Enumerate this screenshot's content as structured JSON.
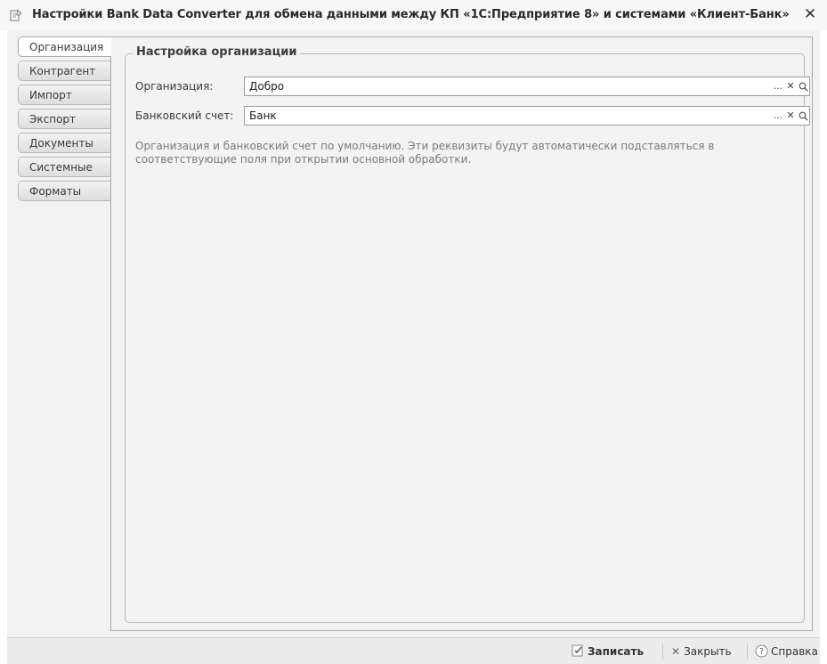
{
  "window": {
    "title": "Настройки Bank Data Converter для обмена данными между КП «1С:Предприятие 8» и системами «Клиент-Банк»",
    "close_label": "✕"
  },
  "tabs": [
    {
      "label": "Организация",
      "active": true
    },
    {
      "label": "Контрагент",
      "active": false
    },
    {
      "label": "Импорт",
      "active": false
    },
    {
      "label": "Экспорт",
      "active": false
    },
    {
      "label": "Документы",
      "active": false
    },
    {
      "label": "Системные",
      "active": false
    },
    {
      "label": "Форматы",
      "active": false
    }
  ],
  "group": {
    "title": "Настройка организации",
    "fields": [
      {
        "label": "Организация:",
        "value": "Добро"
      },
      {
        "label": "Банковский счет:",
        "value": "Банк"
      }
    ],
    "field_buttons": {
      "select": "...",
      "clear": "✕",
      "open": "🔍"
    },
    "hint": "Организация и банковский счет по умолчанию. Эти реквизиты будут автоматически подставляться в соответствующие поля при открытии основной обработки."
  },
  "footer": {
    "save_label": "Записать",
    "close_label": "Закрыть",
    "help_label": "Справка"
  },
  "colors": {
    "window_bg": "#f2f2f2",
    "border": "#a9a9a9",
    "hint_text": "#7a7a7a"
  }
}
